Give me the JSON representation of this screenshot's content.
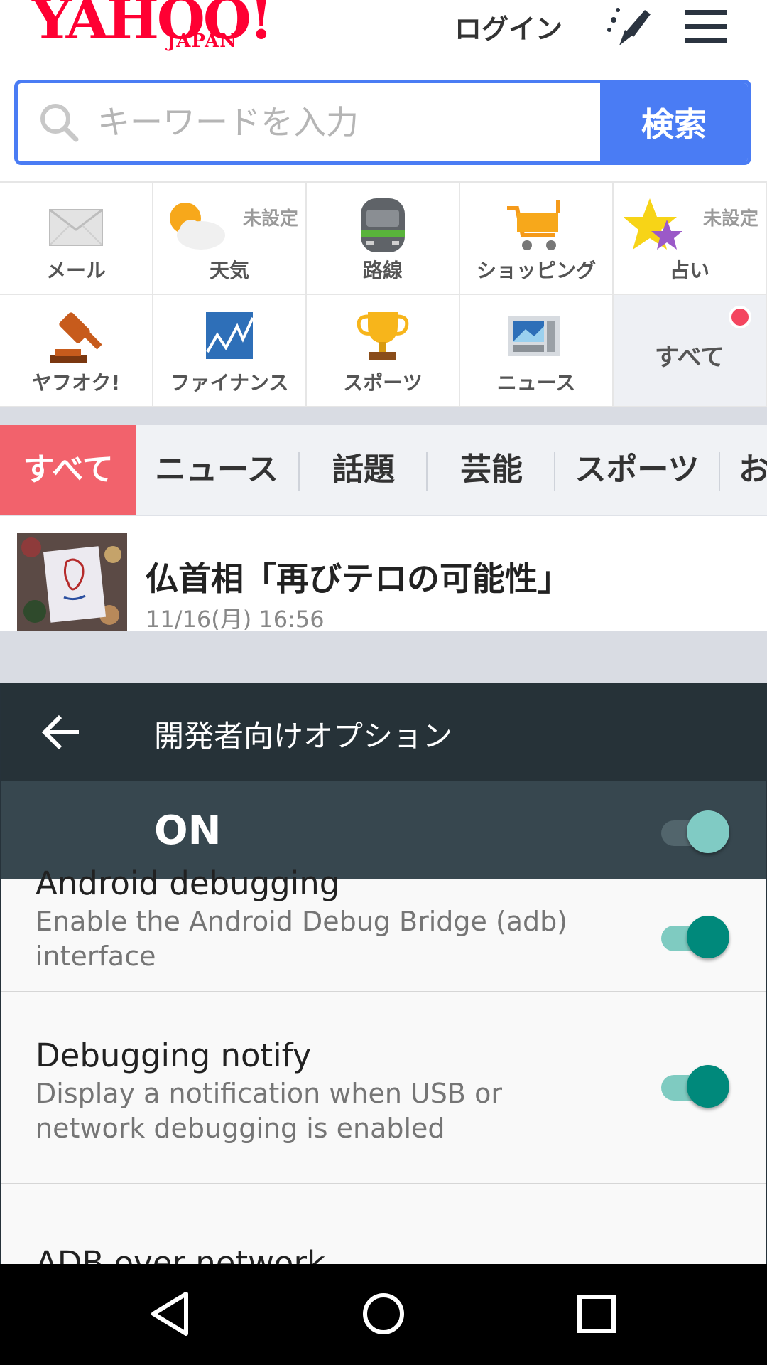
{
  "header": {
    "logo_text": "YAHOO!",
    "logo_sub": "JAPAN",
    "login_label": "ログイン"
  },
  "search": {
    "placeholder": "キーワードを入力",
    "button_label": "検索"
  },
  "services": [
    {
      "label": "メール",
      "sub": ""
    },
    {
      "label": "天気",
      "sub": "未設定"
    },
    {
      "label": "路線",
      "sub": ""
    },
    {
      "label": "ショッピング",
      "sub": ""
    },
    {
      "label": "占い",
      "sub": "未設定"
    },
    {
      "label": "ヤフオク!",
      "sub": ""
    },
    {
      "label": "ファイナンス",
      "sub": ""
    },
    {
      "label": "スポーツ",
      "sub": ""
    },
    {
      "label": "ニュース",
      "sub": ""
    },
    {
      "label": "すべて",
      "sub": ""
    }
  ],
  "category_tabs": [
    "すべて",
    "ニュース",
    "話題",
    "芸能",
    "スポーツ",
    "お"
  ],
  "news": {
    "title": "仏首相「再びテロの可能性」",
    "time": "11/16(月) 16:56"
  },
  "developer_options": {
    "title": "開発者向けオプション",
    "master_label": "ON",
    "master_on": true,
    "items": [
      {
        "title": "Android debugging",
        "summary": "Enable the Android Debug Bridge (adb) interface",
        "on": true
      },
      {
        "title": "Debugging notify",
        "summary": "Display a notification when USB or network debugging is enabled",
        "on": true
      },
      {
        "title": "ADB over network",
        "summary": "",
        "on": false
      }
    ]
  },
  "colors": {
    "yahoo_red": "#ff0033",
    "search_blue": "#4a7cf4",
    "tab_active": "#f2626c",
    "toolbar": "#263238",
    "switch_on": "#00897b"
  }
}
